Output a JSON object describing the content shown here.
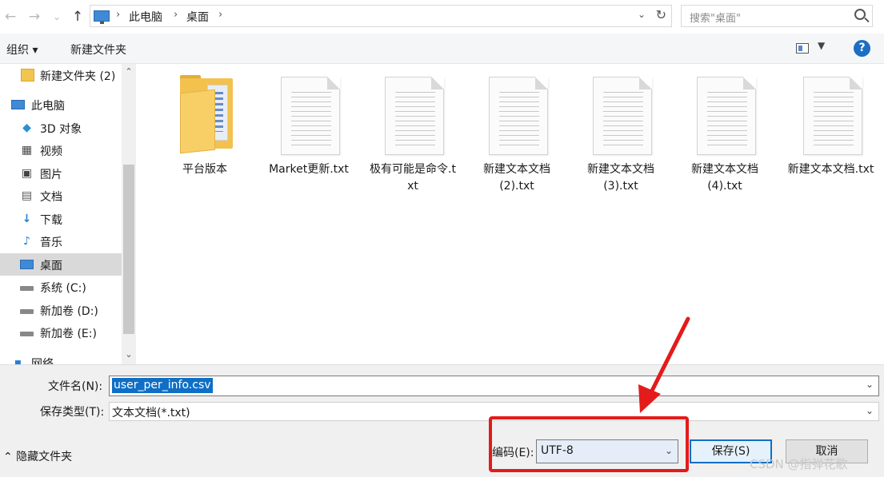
{
  "address_bar": {
    "back_glyph": "←",
    "forward_glyph": "→",
    "recent_glyph": "⌄",
    "up_glyph": "↑",
    "breadcrumb": [
      "此电脑",
      "桌面"
    ],
    "search_placeholder": "搜索\"桌面\""
  },
  "toolbar": {
    "organize": "组织 ▾",
    "new_folder": "新建文件夹"
  },
  "nav": {
    "items": [
      {
        "label": "新建文件夹 (2)",
        "icon": "folder-icon"
      },
      {
        "label": "此电脑",
        "icon": "computer-icon"
      },
      {
        "label": "3D 对象",
        "icon": "cube-icon"
      },
      {
        "label": "视频",
        "icon": "video-icon"
      },
      {
        "label": "图片",
        "icon": "picture-icon"
      },
      {
        "label": "文档",
        "icon": "document-icon"
      },
      {
        "label": "下载",
        "icon": "download-icon"
      },
      {
        "label": "音乐",
        "icon": "music-icon"
      },
      {
        "label": "桌面",
        "icon": "desktop-icon",
        "selected": true
      },
      {
        "label": "系统 (C:)",
        "icon": "drive-icon"
      },
      {
        "label": "新加卷 (D:)",
        "icon": "drive-icon"
      },
      {
        "label": "新加卷 (E:)",
        "icon": "drive-icon"
      },
      {
        "label": "网络",
        "icon": "network-icon"
      }
    ]
  },
  "files": [
    {
      "name": "平台版本",
      "type": "folder"
    },
    {
      "name": "Market更新.txt",
      "type": "txt"
    },
    {
      "name": "极有可能是命令.txt",
      "type": "txt"
    },
    {
      "name": "新建文本文档(2).txt",
      "type": "txt"
    },
    {
      "name": "新建文本文档(3).txt",
      "type": "txt"
    },
    {
      "name": "新建文本文档(4).txt",
      "type": "txt"
    },
    {
      "name": "新建文本文档.txt",
      "type": "txt"
    }
  ],
  "save_panel": {
    "filename_label": "文件名(N):",
    "filename_value": "user_per_info.csv",
    "filetype_label": "保存类型(T):",
    "filetype_value": "文本文档(*.txt)",
    "hide_folders": "⌃ 隐藏文件夹",
    "encoding_label": "编码(E):",
    "encoding_value": "UTF-8",
    "save_button": "保存(S)",
    "cancel_button": "取消"
  },
  "watermark": "CSDN @指弹花歌",
  "colors": {
    "selection_blue": "#0f6fc6",
    "annotation_red": "#e31b1b",
    "nav_selected": "#d9d9d9"
  }
}
